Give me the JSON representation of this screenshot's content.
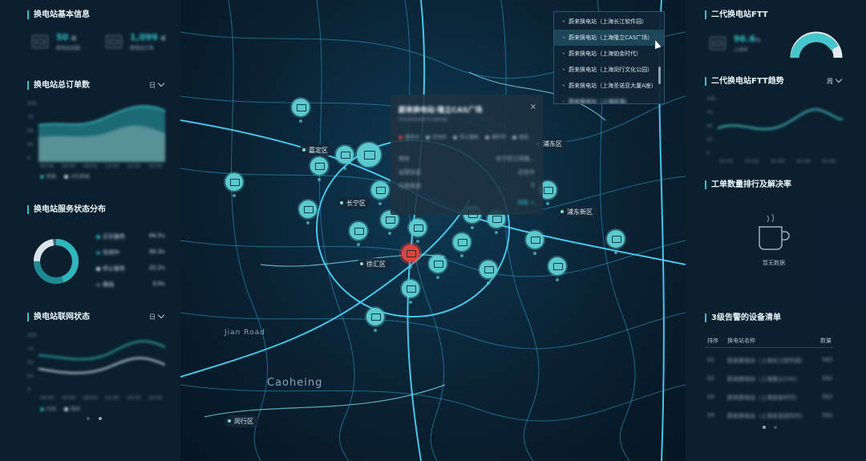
{
  "left": {
    "basic": {
      "title": "换电站基本信息",
      "stat1": {
        "value": "50",
        "unit": "座",
        "label": "换电站总数"
      },
      "stat2": {
        "value": "1,099",
        "unit": "座",
        "label": "换电站订单"
      }
    },
    "orders": {
      "title": "换电站总订单数",
      "range": "日",
      "y_ticks": [
        "100",
        "75",
        "50",
        "25",
        "0"
      ],
      "x_ticks": [
        "00:00",
        "04:00",
        "08:00",
        "12:00",
        "16:00",
        "20:00"
      ],
      "legend": [
        "数据",
        "对比数据"
      ]
    },
    "status": {
      "title": "换电站服务状态分布",
      "rows": [
        {
          "label": "正在服务",
          "value": "44.5",
          "unit": "%",
          "color": "#2fb7be"
        },
        {
          "label": "空闲中",
          "value": "30.3",
          "unit": "%",
          "color": "#1e8b94"
        },
        {
          "label": "停止服务",
          "value": "22.2",
          "unit": "%",
          "color": "#d8e4ea"
        },
        {
          "label": "离线",
          "value": "3.0",
          "unit": "%",
          "color": "#3f6274"
        }
      ]
    },
    "network": {
      "title": "换电站联网状态",
      "range": "日",
      "y_ticks": [
        "100",
        "75",
        "50",
        "25",
        "0"
      ],
      "x_ticks": [
        "00:00",
        "04:00",
        "08:00",
        "12:00",
        "16:00",
        "20:00"
      ],
      "legend": [
        "在线",
        "离线"
      ]
    }
  },
  "map": {
    "districts": [
      "嘉定区",
      "长宁区",
      "徐汇区",
      "闵行区",
      "浦东新区",
      "浦东区"
    ],
    "labels": [
      "Caoheing",
      "Jian Road"
    ],
    "popup": {
      "title": "蔚来换电站·隆立CAS广场",
      "sub": "PSVVAS0007S0B00S",
      "close": "×",
      "legend": [
        "服务中",
        "空闲中",
        "停止服务",
        "维护中",
        "离线"
      ],
      "rows": [
        {
          "k": "地址",
          "v": "长宁区江苏路..."
        },
        {
          "k": "运营状态",
          "v": "正在中"
        },
        {
          "k": "可用电池",
          "v": "5"
        }
      ],
      "more": "详情 >"
    },
    "stations": [
      "蔚来换电站（上海长江软件园）",
      "蔚来换电站（上海隆立CAS广场）",
      "蔚来换电站（上海铂金时代）",
      "蔚来换电站（上海闵行文化公园）",
      "蔚来换电站（上海圣诺亚大厦A座）",
      "蔚来换电站（上海前滩）"
    ]
  },
  "right": {
    "ftt": {
      "title": "二代换电站FTT",
      "value": "96.6",
      "unit": "%",
      "label": "上海市"
    },
    "ftt_trend": {
      "title": "二代换电站FTT趋势",
      "range": "周",
      "y_ticks": [
        "100",
        "75",
        "50",
        "25",
        "0"
      ],
      "x_ticks": [
        "01-01",
        "01-02",
        "01-03",
        "01-04",
        "01-05"
      ]
    },
    "ranking": {
      "title": "工单数量排行及解决率",
      "empty": "暂无数据"
    },
    "alarm": {
      "title": "3级告警的设备清单",
      "headers": [
        "排序",
        "换电站名称",
        "数量"
      ],
      "rows": [
        {
          "no": "01",
          "name": "蔚来换电站（上海长江软件园）",
          "count": "562"
        },
        {
          "no": "02",
          "name": "蔚来换电站（上海隆立CAS）",
          "count": "562"
        },
        {
          "no": "03",
          "name": "蔚来换电站（上海铂金时代）",
          "count": "562"
        },
        {
          "no": "04",
          "name": "蔚来换电站（上海圣诺亚时代）",
          "count": "562"
        }
      ]
    }
  }
}
